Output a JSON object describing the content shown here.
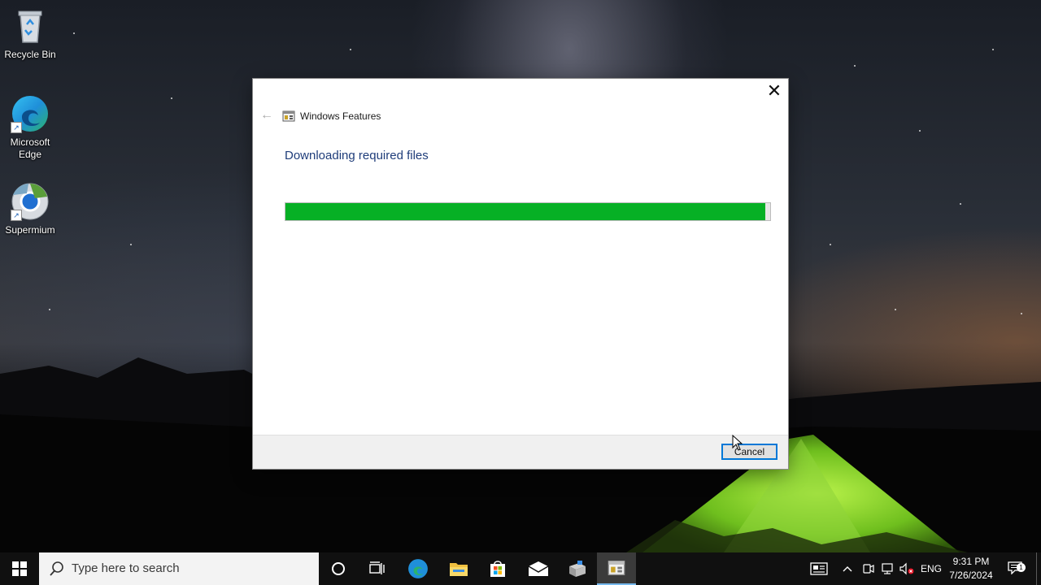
{
  "desktop": {
    "icons": [
      {
        "label": "Recycle Bin",
        "icon": "recycle-bin-icon"
      },
      {
        "label": "Microsoft Edge",
        "icon": "edge-icon"
      },
      {
        "label": "Supermium",
        "icon": "supermium-icon"
      }
    ]
  },
  "dialog": {
    "title": "Windows Features",
    "heading": "Downloading required files",
    "progress_fraction": 0.99,
    "progress_color": "#06b025",
    "cancel_label": "Cancel",
    "accent_color": "#0078d7"
  },
  "taskbar": {
    "search_placeholder": "Type here to search",
    "pinned_apps": [
      "cortana-icon",
      "task-view-icon",
      "edge-icon",
      "file-explorer-icon",
      "microsoft-store-icon",
      "mail-icon",
      "windows-features-installer-icon",
      "windows-features-icon"
    ],
    "tray": {
      "language": "ENG",
      "time": "9:31 PM",
      "date": "7/26/2024",
      "notification_count": "1"
    }
  }
}
